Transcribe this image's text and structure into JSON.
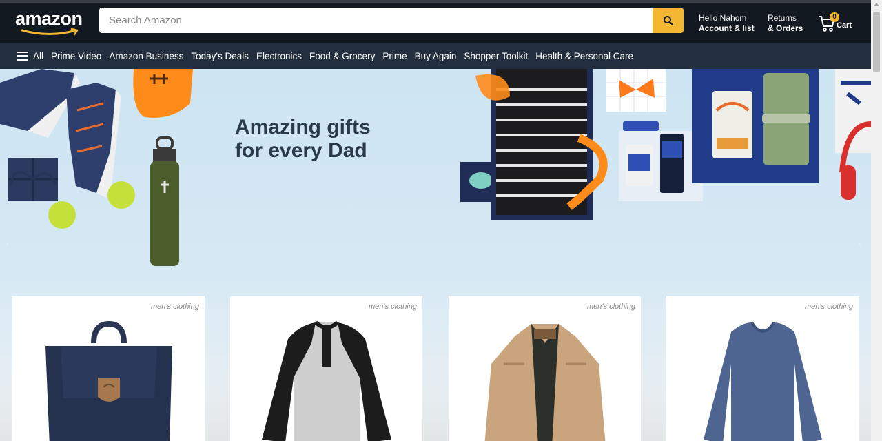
{
  "header": {
    "logo_text": "amazon",
    "search_placeholder": "Search Amazon",
    "account_greeting": "Hello Nahom",
    "account_label": "Account & list",
    "returns_line1": "Returns",
    "returns_line2": "& Orders",
    "cart_count": "0",
    "cart_label": "Cart",
    "accent_color": "#f3b732"
  },
  "subnav": {
    "all": "All",
    "items": [
      "Prime Video",
      "Amazon Business",
      "Today's Deals",
      "Electronics",
      "Food & Grocery",
      "Prime",
      "Buy Again",
      "Shopper Toolkit",
      "Health & Personal Care"
    ]
  },
  "hero": {
    "title_line1": "Amazing gifts",
    "title_line2": "for every Dad",
    "prev_arrow": "‹",
    "next_arrow": "›"
  },
  "products": [
    {
      "category": "men's clothing",
      "image": "backpack-icon"
    },
    {
      "category": "men's clothing",
      "image": "henley-shirt-icon"
    },
    {
      "category": "men's clothing",
      "image": "jacket-icon"
    },
    {
      "category": "men's clothing",
      "image": "long-sleeve-tee-icon"
    }
  ]
}
